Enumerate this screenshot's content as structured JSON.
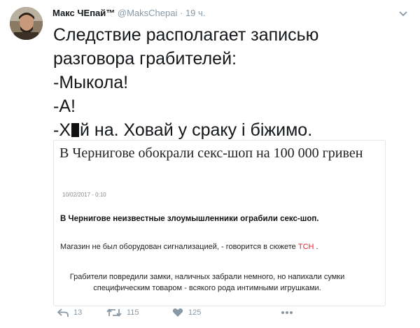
{
  "tweet": {
    "author_name": "Макс ЧЕпай™",
    "handle": "@MaksChepai",
    "separator": "·",
    "time": "19 ч.",
    "lines": [
      "Следствие располагает записью",
      "разговора грабителей:",
      "-Мыкола!",
      "-А!"
    ],
    "last_line_start": "-Х",
    "last_line_end": "й на. Ховай у сраку і біжимо."
  },
  "card": {
    "title": "В Чернигове обокрали секс-шоп на 100 000 гривен",
    "date": "10/02/2017 - 0:10",
    "lead": "В Чернигове неизвестные злоумышленники ограбили секс-шоп.",
    "p1_before": "Магазин не был оборудован сигнализацией, - говорится в сюжете ",
    "p1_link": "ТСН",
    "p1_after": " .",
    "p2": "Грабители повредили замки, наличных забрали немного, но напихали сумки специфическим товаром - всякого рода интимными игрушками."
  },
  "actions": {
    "reply_count": "13",
    "retweet_count": "115",
    "like_count": "125"
  },
  "colors": {
    "text": "#14171a",
    "muted": "#8899a6",
    "link_red": "#e3212f",
    "border": "#e1e8ed"
  },
  "icons": [
    "avatar",
    "chevron-down-icon",
    "reply-icon",
    "retweet-icon",
    "heart-icon",
    "more-icon"
  ]
}
